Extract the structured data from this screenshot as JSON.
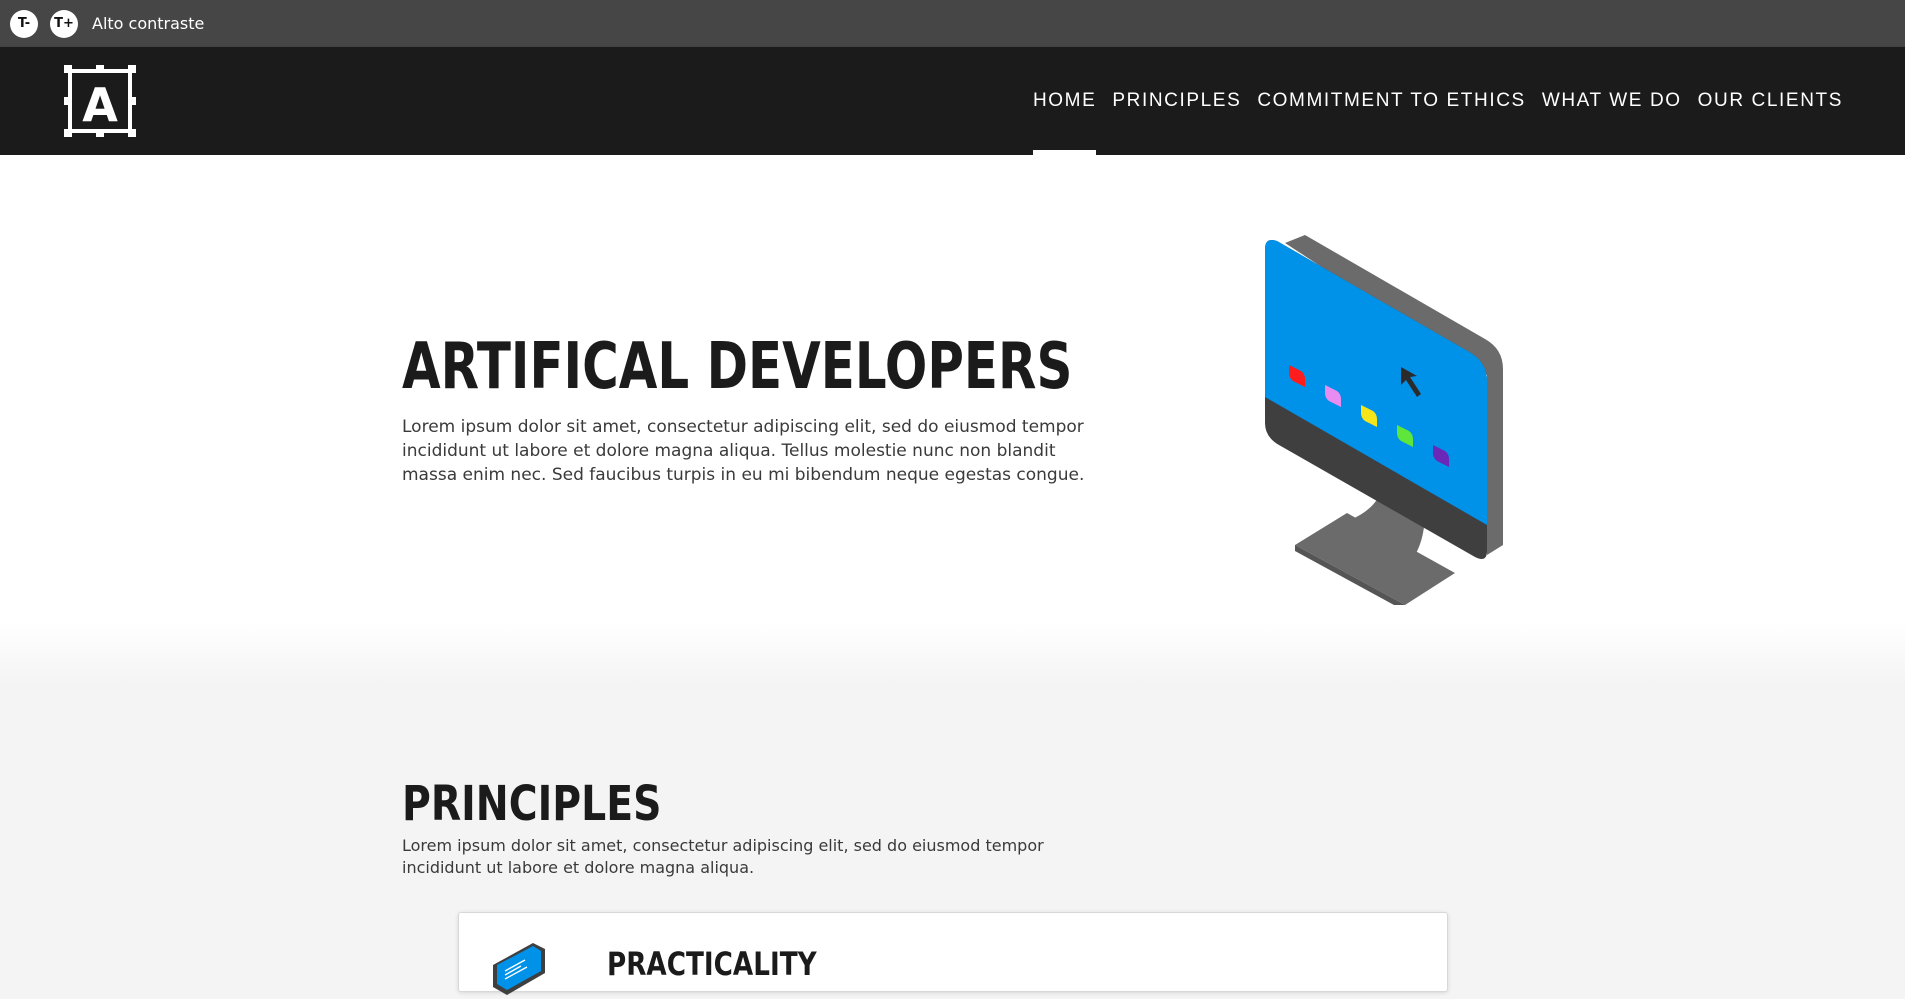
{
  "accessibility_bar": {
    "decrease_font_label": "T-",
    "increase_font_label": "T+",
    "contrast_label": "Alto contraste"
  },
  "header": {
    "logo_letter": "A",
    "nav": [
      {
        "label": "HOME",
        "active": true
      },
      {
        "label": "PRINCIPLES",
        "active": false
      },
      {
        "label": "COMMITMENT TO ETHICS",
        "active": false
      },
      {
        "label": "WHAT WE DO",
        "active": false
      },
      {
        "label": "OUR CLIENTS",
        "active": false
      }
    ]
  },
  "hero": {
    "title": "ARTIFICAL DEVELOPERS",
    "text": "Lorem ipsum dolor sit amet, consectetur adipiscing elit, sed do eiusmod tempor incididunt ut labore et dolore magna aliqua. Tellus molestie nunc non blandit massa enim nec. Sed faucibus turpis in eu mi bibendum neque egestas congue."
  },
  "principles": {
    "title": "PRINCIPLES",
    "text": "Lorem ipsum dolor sit amet, consectetur adipiscing elit, sed do eiusmod tempor incididunt ut labore et dolore magna aliqua.",
    "cards": [
      {
        "title": "PRACTICALITY",
        "icon": "laptop-icon"
      }
    ]
  },
  "colors": {
    "topbar": "#464646",
    "header": "#1b1b1b",
    "screen": "#0091e8",
    "monitor_body": "#6b6b6b",
    "monitor_dark": "#3f3f3f",
    "tile_red": "#ff1c1c",
    "tile_pink": "#e98cf1",
    "tile_yellow": "#f5e51a",
    "tile_green": "#5ee63a",
    "tile_purple": "#6a27b8"
  }
}
